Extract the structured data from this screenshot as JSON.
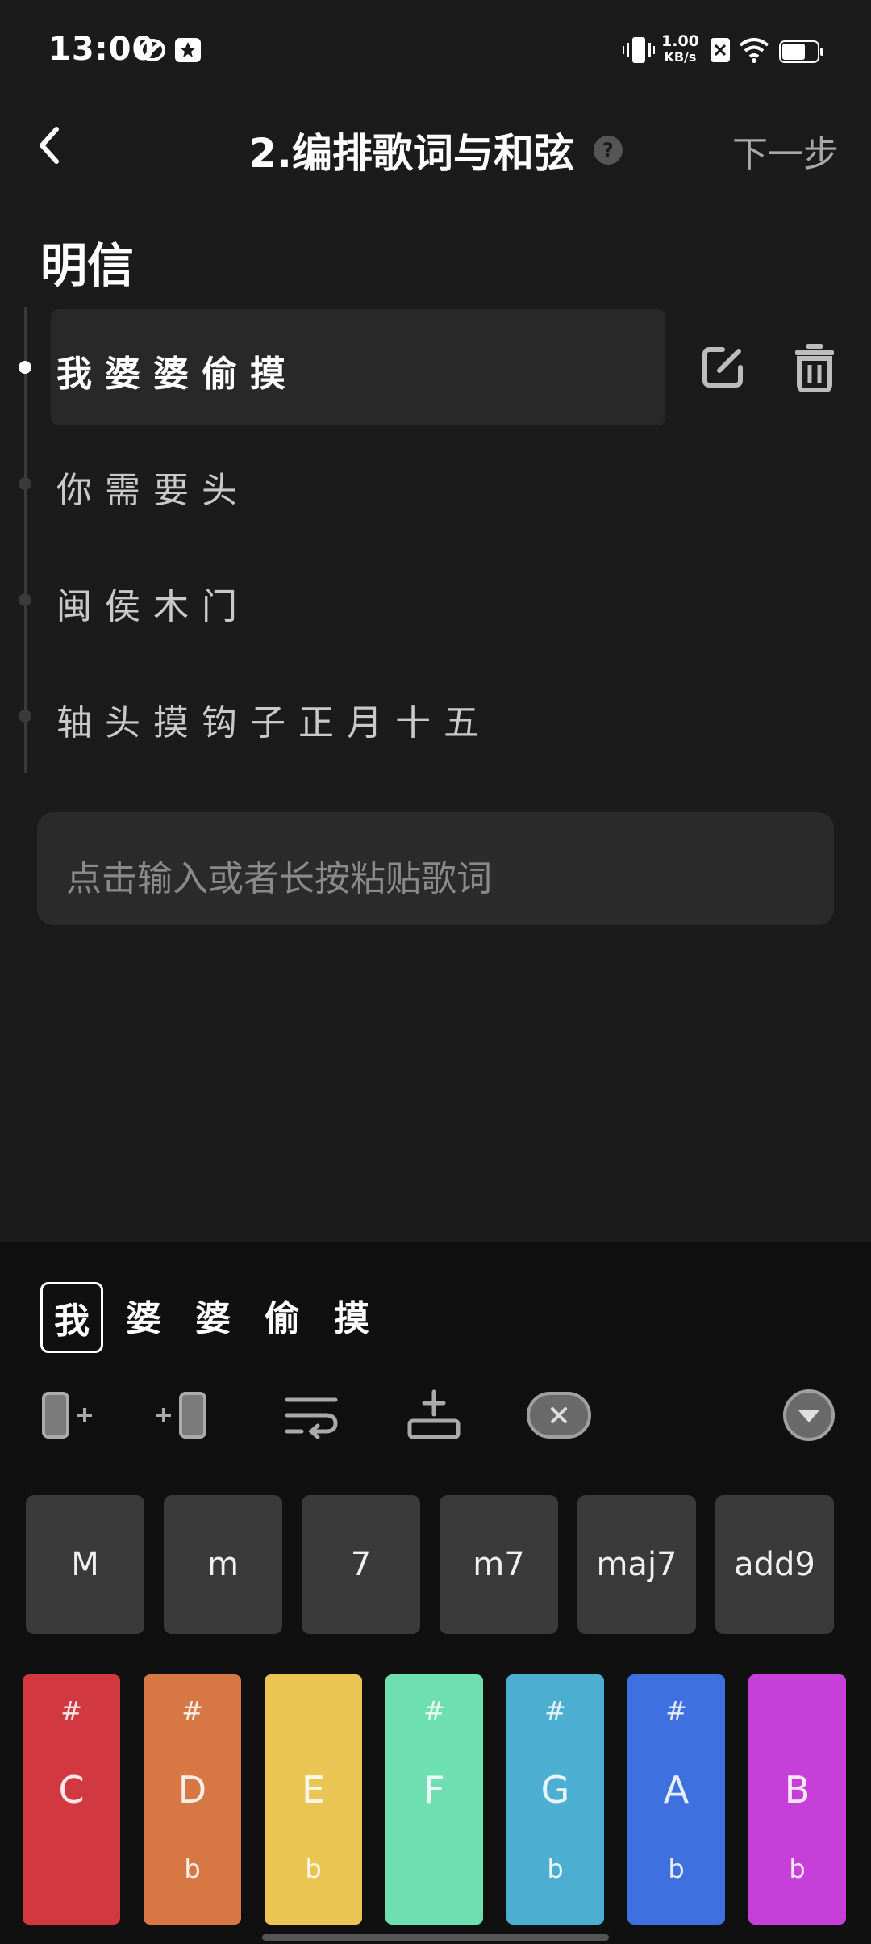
{
  "status_bar": {
    "time": "13:00",
    "net_speed_value": "1.00",
    "net_speed_unit": "KB/s"
  },
  "header": {
    "title": "2.编排歌词与和弦",
    "help": "?",
    "next": "下一步"
  },
  "song": {
    "title": "明信"
  },
  "lyrics": [
    {
      "text": "我婆婆偷摸",
      "active": true
    },
    {
      "text": "你需要头",
      "active": false
    },
    {
      "text": "闽侯木门",
      "active": false
    },
    {
      "text": "轴头摸钩子正月十五",
      "active": false
    }
  ],
  "input": {
    "placeholder": "点击输入或者长按粘贴歌词"
  },
  "panel": {
    "chars": [
      "我",
      "婆",
      "婆",
      "偷",
      "摸"
    ],
    "chord_types": [
      "M",
      "m",
      "7",
      "m7",
      "maj7",
      "add9"
    ],
    "keys": [
      {
        "name": "C",
        "sharp": "#",
        "flat": "",
        "color": "#d23840"
      },
      {
        "name": "D",
        "sharp": "#",
        "flat": "b",
        "color": "#d77844"
      },
      {
        "name": "E",
        "sharp": "",
        "flat": "b",
        "color": "#ebc553"
      },
      {
        "name": "F",
        "sharp": "#",
        "flat": "",
        "color": "#6ddfb0"
      },
      {
        "name": "G",
        "sharp": "#",
        "flat": "b",
        "color": "#4caed0"
      },
      {
        "name": "A",
        "sharp": "#",
        "flat": "b",
        "color": "#3f70df"
      },
      {
        "name": "B",
        "sharp": "",
        "flat": "b",
        "color": "#c63fd9"
      }
    ]
  },
  "icons": [
    "back-arrow-icon",
    "edit-icon",
    "trash-icon",
    "add-bar-left-icon",
    "add-bar-right-icon",
    "line-wrap-icon",
    "insert-line-icon",
    "clear-icon",
    "collapse-icon"
  ]
}
